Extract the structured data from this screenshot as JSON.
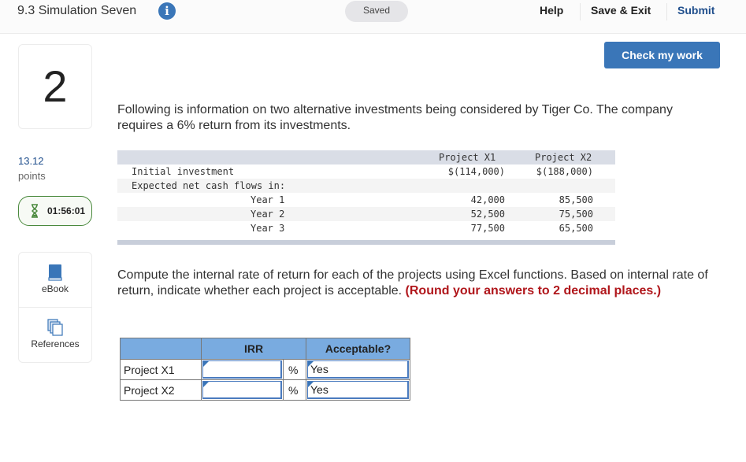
{
  "header": {
    "title": "9.3 Simulation Seven",
    "info_icon": "info-icon",
    "saved_label": "Saved",
    "help_label": "Help",
    "save_exit_label": "Save & Exit",
    "submit_label": "Submit"
  },
  "check_button_label": "Check my work",
  "sidebar": {
    "question_number": "2",
    "points_value": "13.12",
    "points_label": "points",
    "timer": "01:56:01",
    "tools": [
      {
        "label": "eBook",
        "icon": "book-icon"
      },
      {
        "label": "References",
        "icon": "references-icon"
      }
    ]
  },
  "question": {
    "intro": "Following is information on two alternative investments being considered by Tiger Co. The company requires a 6% return from its investments.",
    "instructions": "Compute the internal rate of return for each of the projects using Excel functions. Based on internal rate of return, indicate whether each project is acceptable.",
    "instructions_emphasis": "(Round your answers to 2 decimal places.)"
  },
  "given_table": {
    "headers": [
      "Project X1",
      "Project X2"
    ],
    "rows": [
      {
        "label": "Initial investment",
        "x1": "$(114,000)",
        "x2": "$(188,000)"
      },
      {
        "label": "Expected net cash flows in:",
        "x1": "",
        "x2": ""
      },
      {
        "label": "Year 1",
        "x1": "42,000",
        "x2": "85,500"
      },
      {
        "label": "Year 2",
        "x1": "52,500",
        "x2": "75,500"
      },
      {
        "label": "Year 3",
        "x1": "77,500",
        "x2": "65,500"
      }
    ]
  },
  "answer_table": {
    "headers": [
      "",
      "IRR",
      "Acceptable?"
    ],
    "unit": "%",
    "rows": [
      {
        "label": "Project X1",
        "irr": "",
        "acceptable": "Yes"
      },
      {
        "label": "Project X2",
        "irr": "",
        "acceptable": "Yes"
      }
    ]
  },
  "colors": {
    "accent": "#3a76b8",
    "submit": "#1f4e8c",
    "emphasis": "#b0161b",
    "timer_border": "#4b8a3e",
    "answer_header": "#79abe0"
  }
}
